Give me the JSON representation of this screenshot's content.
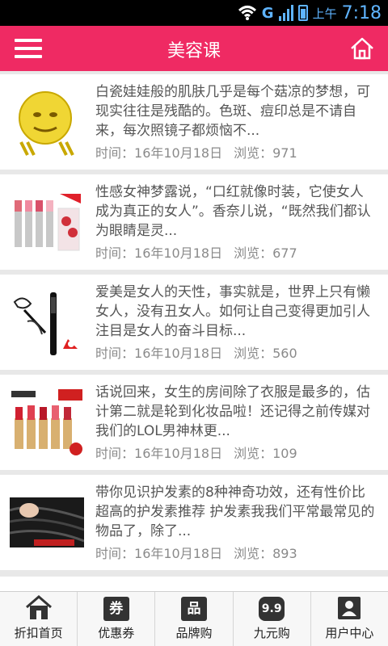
{
  "status": {
    "network": "G",
    "ampm": "上午",
    "time": "7:18"
  },
  "header": {
    "title": "美容课"
  },
  "articles": [
    {
      "text": "白瓷娃娃般的肌肤几乎是每个菇凉的梦想，可现实往往是残酷的。色斑、痘印总是不请自来，每次照镜子都烦恼不...",
      "date_label": "时间：",
      "date": "16年10月18日",
      "views_label": "浏览：",
      "views": "971",
      "thumb": "smiley-face-image"
    },
    {
      "text": "性感女神梦露说，“口红就像时装，它使女人成为真正的女人”。香奈儿说，“既然我们都认为眼睛是灵...",
      "date_label": "时间：",
      "date": "16年10月18日",
      "views_label": "浏览：",
      "views": "677",
      "thumb": "lipstick-product-image"
    },
    {
      "text": "爱美是女人的天性，事实就是，世界上只有懒女人，没有丑女人。如何让自己变得更加引人注目是女人的奋斗目标...",
      "date_label": "时间：",
      "date": "16年10月18日",
      "views_label": "浏览：",
      "views": "560",
      "thumb": "mascara-product-image"
    },
    {
      "text": "话说回来，女生的房间除了衣服是最多的，估计第二就是轮到化妆品啦！还记得之前传媒对我们的LOL男神林更...",
      "date_label": "时间：",
      "date": "16年10月18日",
      "views_label": "浏览：",
      "views": "109",
      "thumb": "lipstick-set-image"
    },
    {
      "text": "带你见识护发素的8种神奇功效，还有性价比超高的护发素推荐 护发素我我们平常最常见的物品了，除了...",
      "date_label": "时间：",
      "date": "16年10月18日",
      "views_label": "浏览：",
      "views": "893",
      "thumb": "hair-image"
    }
  ],
  "tabs": [
    {
      "label": "折扣首页",
      "icon": "home-icon"
    },
    {
      "label": "优惠券",
      "icon": "coupon-icon",
      "glyph": "券"
    },
    {
      "label": "品牌购",
      "icon": "brand-icon",
      "glyph": "品"
    },
    {
      "label": "九元购",
      "icon": "nine-yuan-icon",
      "glyph": "9.9"
    },
    {
      "label": "用户中心",
      "icon": "user-icon"
    }
  ]
}
